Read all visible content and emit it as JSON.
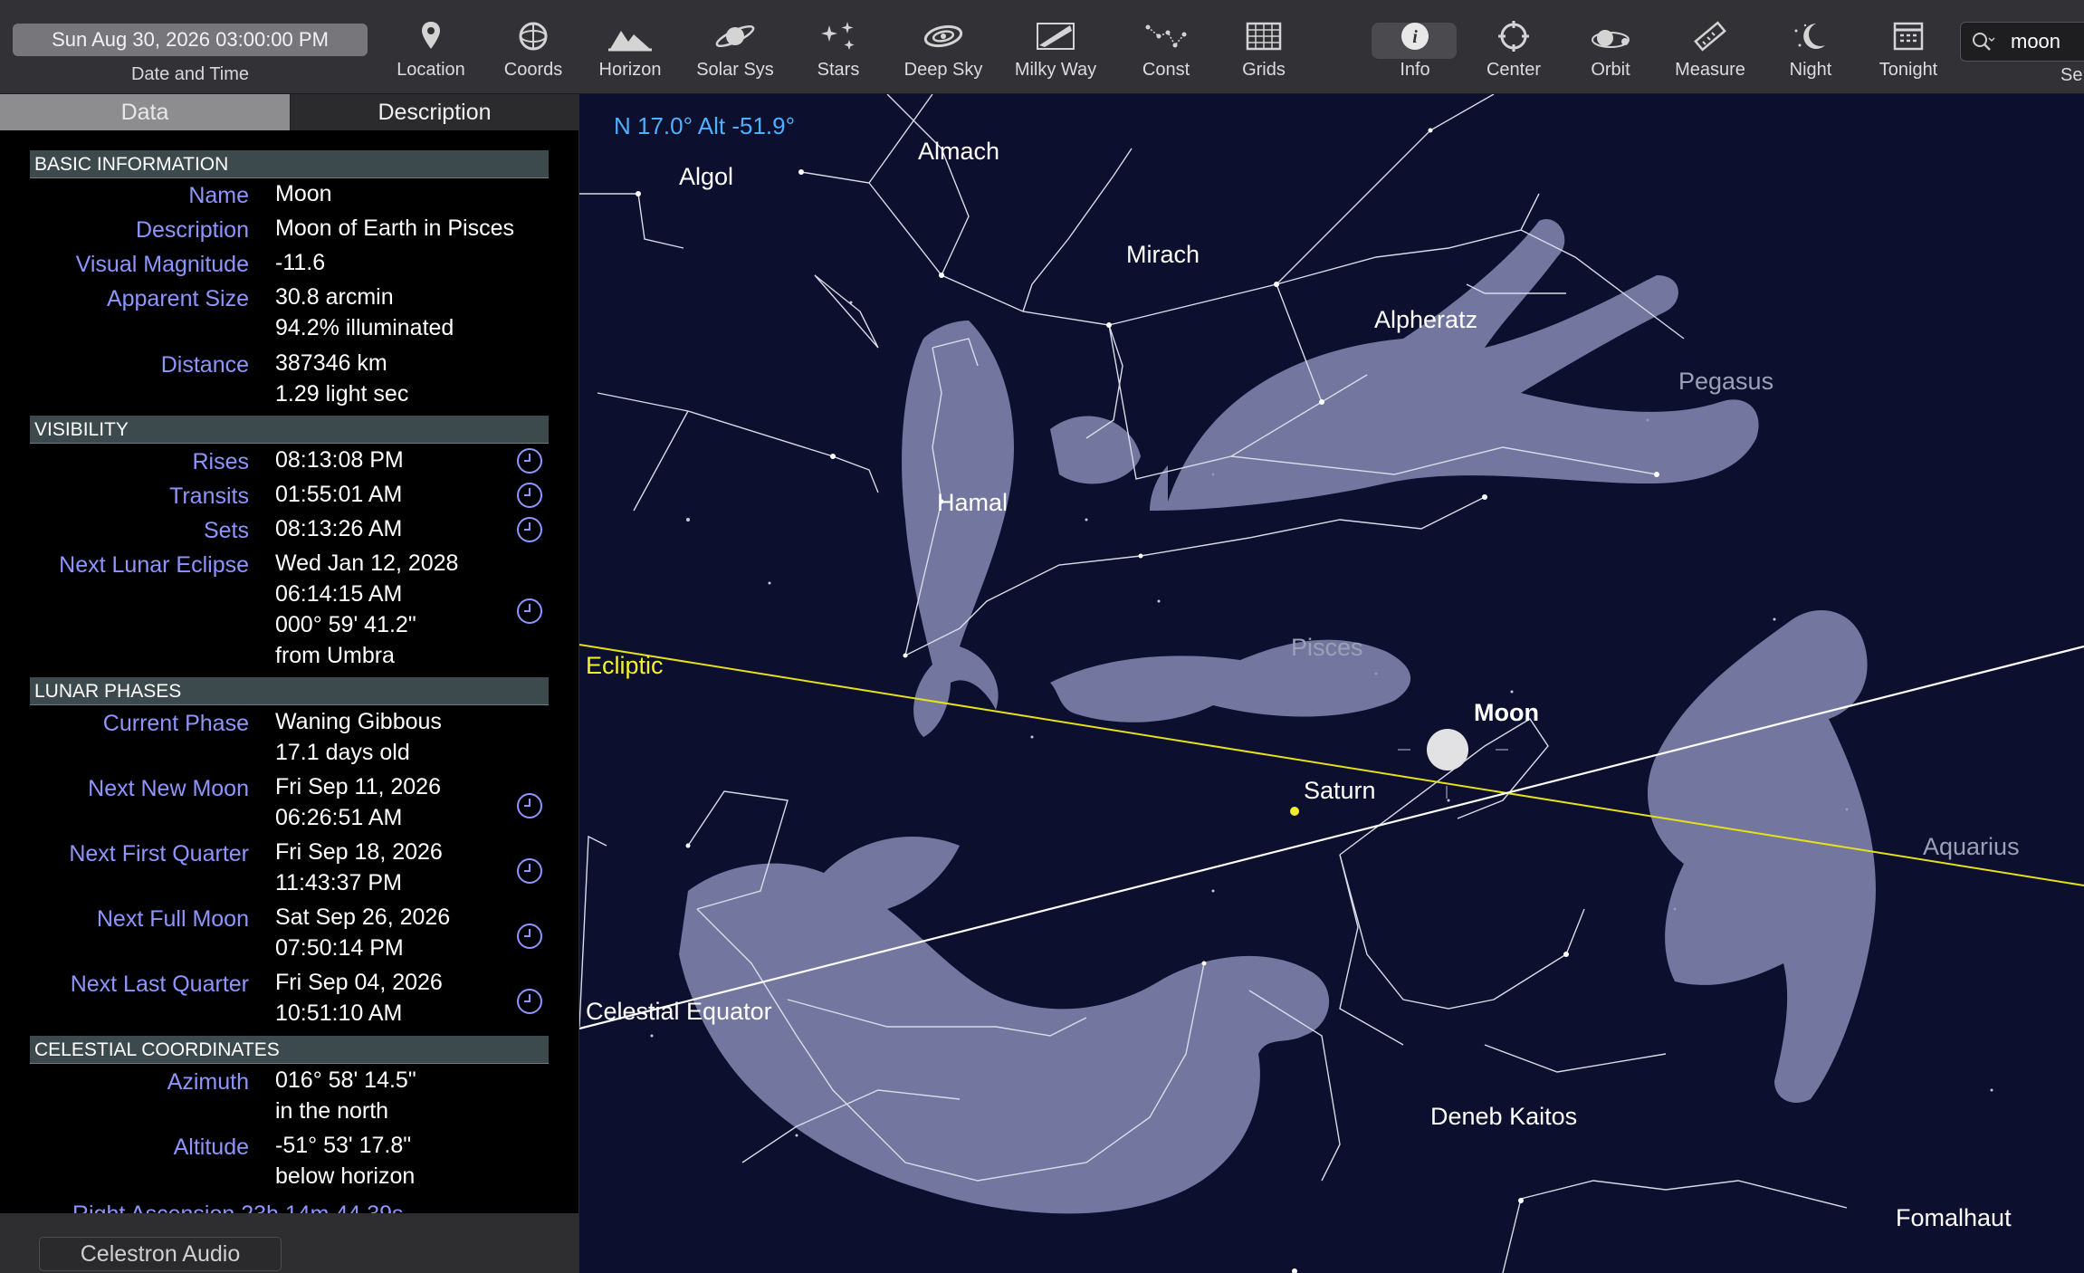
{
  "toolbar": {
    "datetime": "Sun Aug 30, 2026  03:00:00 PM",
    "datetime_caption": "Date and Time",
    "buttons": [
      "Location",
      "Coords",
      "Horizon",
      "Solar Sys",
      "Stars",
      "Deep Sky",
      "Milky Way",
      "Const",
      "Grids",
      "Info",
      "Center",
      "Orbit",
      "Measure",
      "Night",
      "Tonight"
    ],
    "search_value": "moon",
    "search_caption": "Se"
  },
  "sidebar": {
    "tabs": [
      "Data",
      "Description"
    ],
    "sections": {
      "basic": "BASIC INFORMATION",
      "visibility": "VISIBILITY",
      "phases": "LUNAR PHASES",
      "coords": "CELESTIAL COORDINATES"
    },
    "basic": {
      "name_label": "Name",
      "name": "Moon",
      "desc_label": "Description",
      "desc": "Moon of Earth in Pisces",
      "mag_label": "Visual Magnitude",
      "mag": "-11.6",
      "size_label": "Apparent Size",
      "size": "30.8 arcmin",
      "illum": "94.2% illuminated",
      "dist_label": "Distance",
      "dist_km": "387346 km",
      "dist_ls": "1.29 light sec"
    },
    "visibility": {
      "rises_label": "Rises",
      "rises": "08:13:08 PM",
      "transits_label": "Transits",
      "transits": "01:55:01 AM",
      "sets_label": "Sets",
      "sets": "08:13:26 AM",
      "eclipse_label": "Next Lunar Eclipse",
      "eclipse_date": "Wed Jan 12, 2028",
      "eclipse_time": "06:14:15 AM",
      "eclipse_sep": "000° 59' 41.2\"",
      "eclipse_from": "from Umbra"
    },
    "phases": {
      "current_label": "Current Phase",
      "current": "Waning Gibbous",
      "age": "17.1 days old",
      "new_label": "Next New Moon",
      "new_date": "Fri Sep 11, 2026",
      "new_time": "06:26:51 AM",
      "first_label": "Next First Quarter",
      "first_date": "Fri Sep 18, 2026",
      "first_time": "11:43:37 PM",
      "full_label": "Next Full Moon",
      "full_date": "Sat Sep 26, 2026",
      "full_time": "07:50:14 PM",
      "last_label": "Next Last Quarter",
      "last_date": "Fri Sep 04, 2026",
      "last_time": "10:51:10 AM"
    },
    "coords": {
      "az_label": "Azimuth",
      "az": "016° 58' 14.5\"",
      "az_dir": "in the north",
      "alt_label": "Altitude",
      "alt": "-51° 53' 17.8\"",
      "alt_dir": "below horizon",
      "ra_partial": "Right Ascension  23h 14m 44.39s"
    },
    "footer_button": "Celestron Audio"
  },
  "sky": {
    "readout": "N 17.0° Alt -51.9°",
    "labels": {
      "algol": "Algol",
      "almach": "Almach",
      "mirach": "Mirach",
      "alpheratz": "Alpheratz",
      "pegasus": "Pegasus",
      "hamal": "Hamal",
      "pisces": "Pisces",
      "ecliptic": "Ecliptic",
      "moon": "Moon",
      "saturn": "Saturn",
      "aquarius": "Aquarius",
      "celestial_equator": "Celestial Equator",
      "deneb_kaitos": "Deneb Kaitos",
      "fomalhaut": "Fomalhaut"
    },
    "colors": {
      "ecliptic": "#e6e01a",
      "equator": "#ffffff",
      "readout": "#4db1ff",
      "label_link": "#8f95ff"
    }
  }
}
